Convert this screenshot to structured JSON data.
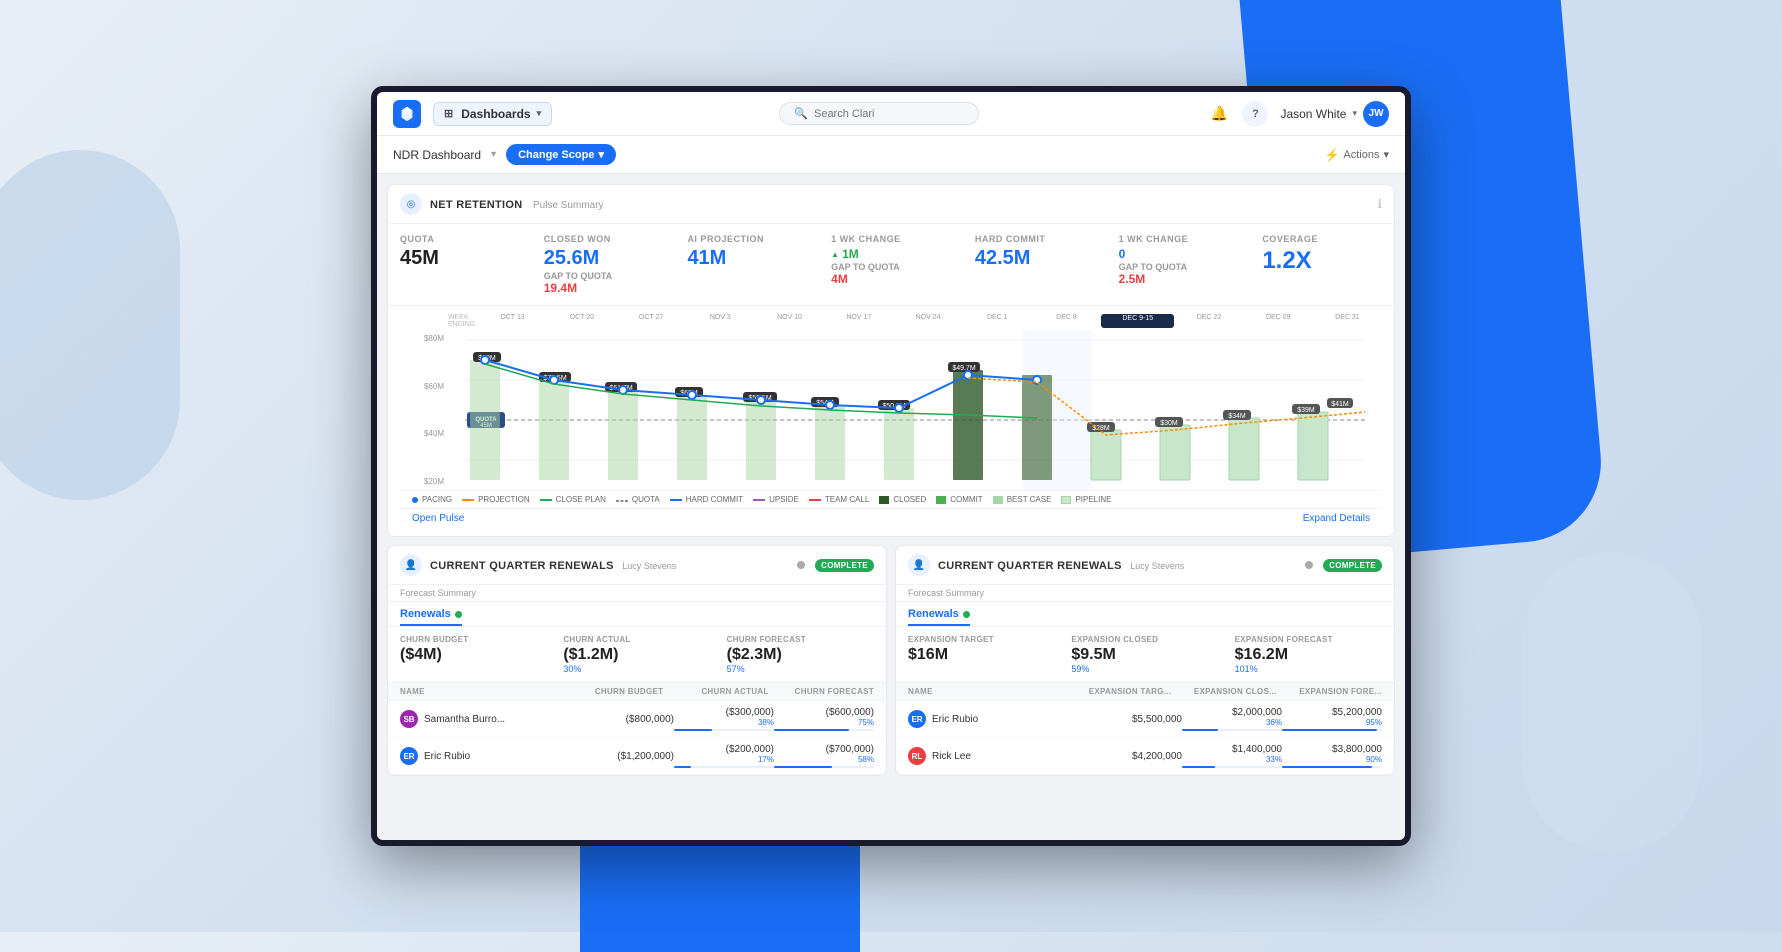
{
  "background": {
    "color": "#e8eef5"
  },
  "nav": {
    "logo_text": "C",
    "dashboards_label": "Dashboards",
    "search_placeholder": "Search Clari",
    "user_name": "Jason White",
    "user_initials": "JW",
    "notification_icon": "🔔",
    "help_icon": "?",
    "chevron": "▾"
  },
  "sub_nav": {
    "title": "NDR Dashboard",
    "change_scope_label": "Change Scope",
    "actions_label": "Actions"
  },
  "pulse_card": {
    "title": "NET RETENTION",
    "subtitle": "Pulse Summary",
    "metrics": {
      "quota": {
        "label": "QUOTA",
        "value": "45M"
      },
      "closed_won": {
        "label": "CLOSED WON",
        "value": "25.6M",
        "sub_label": "GAP TO QUOTA",
        "sub_value": "19.4M"
      },
      "ai_projection": {
        "label": "AI PROJECTION",
        "value": "41M"
      },
      "wk_change_1": {
        "label": "1 WK CHANGE",
        "value": "1M",
        "sub_label": "GAP TO QUOTA",
        "sub_value": "4M"
      },
      "hard_commit": {
        "label": "HARD COMMIT",
        "value": "42.5M"
      },
      "wk_change_2": {
        "label": "1 WK CHANGE",
        "value": "0",
        "sub_label": "GAP TO QUOTA",
        "sub_value": "2.5M"
      },
      "coverage": {
        "label": "COVERAGE",
        "value": "1.2X"
      }
    },
    "chart": {
      "y_labels": [
        "$80M",
        "$60M",
        "$40M",
        "$20M"
      ],
      "week_labels": [
        "WEEK ENDING",
        "OCT 13",
        "OCT 20",
        "OCT 27",
        "NOV 3",
        "NOV 10",
        "NOV 17",
        "NOV 24",
        "DEC 1",
        "DEC 8",
        "DEC 9 - 15",
        "DEC 22",
        "DEC 29",
        "DEC 31"
      ],
      "data_labels": [
        "$80M",
        "$77.5M",
        "$61.7M",
        "$60M",
        "$58.5M",
        "$54M",
        "$50.8M",
        "$49.7M",
        "$28M",
        "$30M",
        "$34M",
        "$39M",
        "$41M"
      ],
      "quota_label": "QUOTA\n45M",
      "legend": [
        {
          "label": "PACING",
          "color": "#1a6ef5",
          "type": "dot"
        },
        {
          "label": "PROJECTION",
          "color": "#ff8c00",
          "type": "line"
        },
        {
          "label": "CLOSE PLAN",
          "color": "#22aa55",
          "type": "line"
        },
        {
          "label": "QUOTA",
          "color": "#888",
          "type": "dash"
        },
        {
          "label": "HARD COMMIT",
          "color": "#1a6ef5",
          "type": "line"
        },
        {
          "label": "UPSIDE",
          "color": "#9b59b6",
          "type": "line"
        },
        {
          "label": "TEAM CALL",
          "color": "#e84040",
          "type": "line"
        },
        {
          "label": "CLOSED",
          "color": "#2d5a27",
          "type": "bar"
        },
        {
          "label": "COMMIT",
          "color": "#4caf50",
          "type": "bar"
        },
        {
          "label": "BEST CASE",
          "color": "#a5d6a7",
          "type": "bar"
        },
        {
          "label": "PIPELINE",
          "color": "#c8e6c9",
          "type": "bar-pattern"
        }
      ]
    },
    "open_pulse_link": "Open Pulse",
    "expand_details_link": "Expand Details"
  },
  "left_renewal_card": {
    "title": "Current Quarter Renewals",
    "owner": "Lucy Stevens",
    "status": "COMPLETE",
    "tab": "Renewals",
    "metrics": {
      "churn_budget": {
        "label": "CHURN BUDGET",
        "value": "($4M)"
      },
      "churn_actual": {
        "label": "CHURN ACTUAL",
        "value": "($1.2M)",
        "pct": "30%"
      },
      "churn_forecast": {
        "label": "CHURN FORECAST",
        "value": "($2.3M)",
        "pct": "57%"
      }
    },
    "table": {
      "columns": [
        "NAME",
        "CHURN BUDGET",
        "CHURN ACTUAL",
        "CHURN FORECAST"
      ],
      "rows": [
        {
          "name": "Samantha Burro...",
          "initials": "SB",
          "color": "#9c27b0",
          "budget": "($800,000)",
          "actual": "($300,000)",
          "actual_pct": "38%",
          "forecast": "($600,000)",
          "forecast_pct": "75%"
        },
        {
          "name": "Eric Rubio",
          "initials": "ER",
          "color": "#1a6ef5",
          "budget": "($1,200,000)",
          "actual": "($200,000)",
          "actual_pct": "17%",
          "forecast": "($700,000)",
          "forecast_pct": "58%"
        }
      ]
    }
  },
  "right_renewal_card": {
    "title": "Current Quarter Renewals",
    "owner": "Lucy Stevens",
    "status": "COMPLETE",
    "tab": "Renewals",
    "metrics": {
      "expansion_target": {
        "label": "EXPANSION TARGET",
        "value": "$16M"
      },
      "expansion_closed": {
        "label": "EXPANSION CLOSED",
        "value": "$9.5M",
        "pct": "59%"
      },
      "expansion_forecast": {
        "label": "EXPANSION FORECAST",
        "value": "$16.2M",
        "pct": "101%"
      }
    },
    "table": {
      "columns": [
        "NAME",
        "EXPANSION TARG...",
        "EXPANSION CLOS...",
        "EXPANSION FORE..."
      ],
      "rows": [
        {
          "name": "Eric Rubio",
          "initials": "ER",
          "color": "#1a6ef5",
          "target": "$5,500,000",
          "closed": "$2,000,000",
          "closed_pct": "36%",
          "forecast": "$5,200,000",
          "forecast_pct": "95%"
        },
        {
          "name": "Rick Lee",
          "initials": "RL",
          "color": "#e84040",
          "target": "$4,200,000",
          "closed": "$1,400,000",
          "closed_pct": "33%",
          "forecast": "$3,800,000",
          "forecast_pct": "90%"
        }
      ]
    }
  }
}
